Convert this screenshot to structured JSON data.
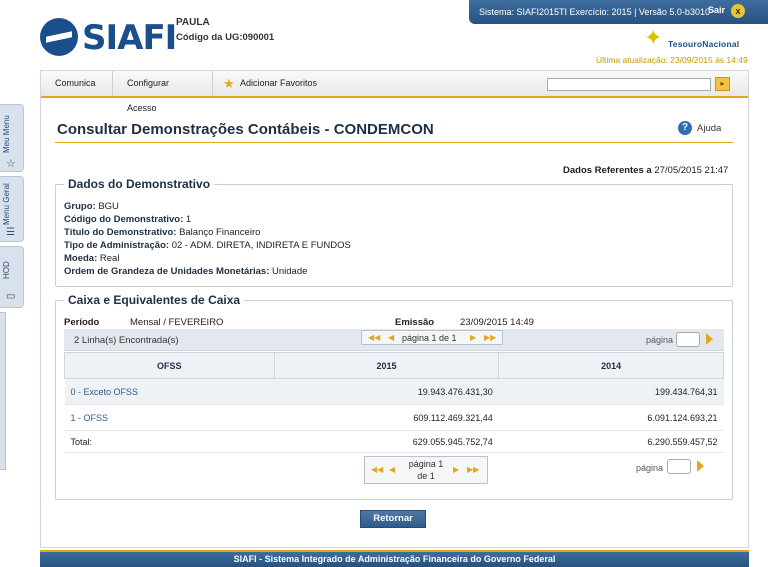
{
  "header": {
    "logo_text": "SIAFI",
    "user_name": "PAULA",
    "ug_label": "Código da UG:",
    "ug_code": "090001",
    "system_info": "Sistema: SIAFI2015TI Exercício: 2015 | Versão 5.0-b3010",
    "logout_label": "Sair",
    "logout_icon": "x",
    "tesouro_text": "TesouroNacional",
    "last_update": "Última atualização: 23/09/2015 às 14:49"
  },
  "side_tabs": [
    "Meu Menu",
    "Menu Geral",
    "HOD"
  ],
  "menu": {
    "items": [
      "Comunica",
      "Configurar Acesso",
      "Adicionar Favoritos"
    ],
    "quick_go": "▸"
  },
  "page": {
    "title": "Consultar Demonstrações Contábeis - CONDEMCON",
    "help_label": "Ajuda",
    "ref_label": "Dados Referentes a",
    "ref_value": "27/05/2015 21:47"
  },
  "demonstrativo": {
    "legend": "Dados do Demonstrativo",
    "fields": [
      {
        "label": "Grupo:",
        "value": "BGU"
      },
      {
        "label": "Código do Demonstrativo:",
        "value": "1"
      },
      {
        "label": "Título do Demonstrativo:",
        "value": "Balanço Financeiro"
      },
      {
        "label": "Tipo de Administração:",
        "value": "02 - ADM. DIRETA, INDIRETA E FUNDOS"
      },
      {
        "label": "Moeda:",
        "value": "Real"
      },
      {
        "label": "Ordem de Grandeza de Unidades Monetárias:",
        "value": "Unidade"
      }
    ]
  },
  "caixa": {
    "legend": "Caixa e Equivalentes de Caixa",
    "periodo_label": "Período",
    "periodo_value": "Mensal / FEVEREIRO",
    "emissao_label": "Emissão",
    "emissao_value": "23/09/2015 14:49",
    "linhas": "2 Linha(s) Encontrada(s)",
    "pager_top": "página 1 de 1",
    "pager_bottom_line1": "página 1",
    "pager_bottom_line2": "de 1",
    "pagina_label": "página",
    "columns": [
      "OFSS",
      "2015",
      "2014"
    ],
    "rows": [
      {
        "name": "0 - Exceto OFSS",
        "v2015": "19.943.476.431,30",
        "v2014": "199.434.764,31"
      },
      {
        "name": "1 - OFSS",
        "v2015": "609.112.469.321,44",
        "v2014": "6.091.124.693,21"
      }
    ],
    "total": {
      "name": "Total:",
      "v2015": "629.055.945.752,74",
      "v2014": "6.290.559.457,52"
    }
  },
  "actions": {
    "retornar": "Retornar"
  },
  "footer": {
    "text": "SIAFI - Sistema Integrado de Administração Financeira do Governo Federal"
  }
}
